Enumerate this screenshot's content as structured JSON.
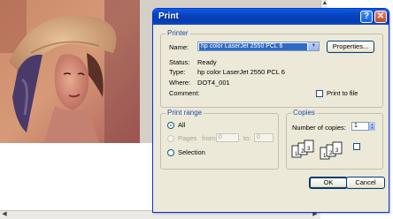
{
  "viewer": {
    "scroll_up": "▲",
    "scroll_down": "▼",
    "scroll_left": "◀",
    "scroll_right": "▶"
  },
  "dialog": {
    "title": "Print",
    "help_glyph": "?",
    "close_glyph": "✕",
    "printer": {
      "group_title": "Printer",
      "name_label": "Name:",
      "name_value": "hp color LaserJet 2550 PCL 6",
      "properties_button": "Properties...",
      "status_label": "Status:",
      "status_value": "Ready",
      "type_label": "Type:",
      "type_value": "hp color LaserJet 2550 PCL 6",
      "where_label": "Where:",
      "where_value": "DOT4_001",
      "comment_label": "Comment:",
      "print_to_file_label": "Print to file",
      "print_to_file_checked": false
    },
    "print_range": {
      "group_title": "Print range",
      "all_label": "All",
      "pages_label": "Pages",
      "from_label": "from:",
      "from_value": "0",
      "to_label": "to:",
      "to_value": "0",
      "selection_label": "Selection",
      "selected": "All"
    },
    "copies": {
      "group_title": "Copies",
      "number_label": "Number of copies:",
      "number_value": "1",
      "collate_digits_1": [
        "1",
        "2",
        "3"
      ],
      "collate_digits_2": [
        "1",
        "2",
        "3"
      ]
    },
    "ok_button": "OK",
    "cancel_button": "Cancel"
  },
  "colors": {
    "titlebar": "#0843c0",
    "dialog_bg": "#ece9d8",
    "selection": "#316ac5",
    "group_title": "#1a4fa0"
  }
}
